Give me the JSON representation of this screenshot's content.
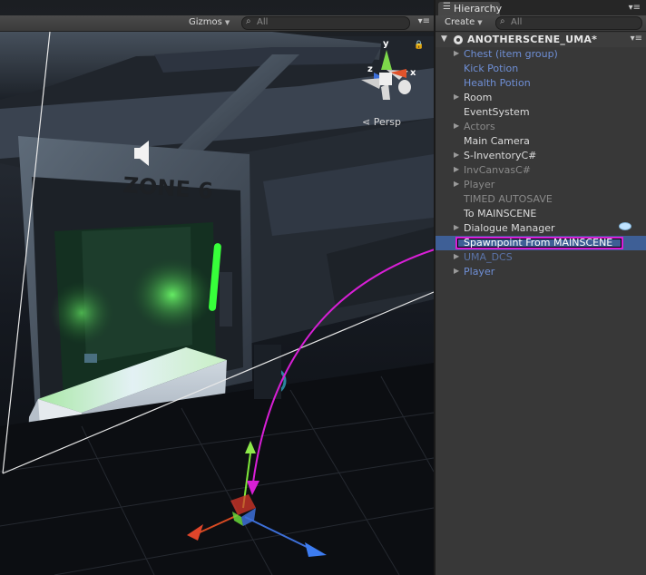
{
  "scene_view": {
    "gizmos_label": "Gizmos",
    "search_placeholder": "All",
    "persp_label": "Persp",
    "scene_text": "ZONE 6",
    "axis_labels": {
      "y": "y",
      "x": "x",
      "z": "z"
    },
    "icons": [
      "speaker-icon",
      "lock-icon",
      "orientation-gizmo",
      "move-tool-gizmo",
      "panel-menu-icon",
      "search-icon"
    ]
  },
  "hierarchy": {
    "tab_label": "Hierarchy",
    "create_label": "Create",
    "search_placeholder": "All",
    "scene_name": "ANOTHERSCENE_UMA*",
    "items": [
      {
        "label": "Chest (item group)",
        "style": "prefab",
        "expandable": true
      },
      {
        "label": "Kick Potion",
        "style": "prefab",
        "expandable": false
      },
      {
        "label": "Health Potion",
        "style": "prefab",
        "expandable": false
      },
      {
        "label": "Room",
        "style": "normal",
        "expandable": true
      },
      {
        "label": "EventSystem",
        "style": "normal",
        "expandable": false
      },
      {
        "label": "Actors",
        "style": "inactive",
        "expandable": true
      },
      {
        "label": "Main Camera",
        "style": "normal",
        "expandable": false
      },
      {
        "label": "S-InventoryC#",
        "style": "normal",
        "expandable": true
      },
      {
        "label": "InvCanvasC#",
        "style": "inactive",
        "expandable": true
      },
      {
        "label": "Player",
        "style": "inactive",
        "expandable": true
      },
      {
        "label": "TIMED AUTOSAVE",
        "style": "inactive",
        "expandable": false
      },
      {
        "label": "To MAINSCENE",
        "style": "normal",
        "expandable": false
      },
      {
        "label": "Dialogue Manager",
        "style": "normal",
        "expandable": true
      },
      {
        "label": "Spawnpoint From MAINSCENE",
        "style": "selected",
        "expandable": false
      },
      {
        "label": "UMA_DCS",
        "style": "prefab-inactive",
        "expandable": true
      },
      {
        "label": "Player",
        "style": "prefab",
        "expandable": true
      }
    ]
  },
  "colors": {
    "selection_bg": "#3e5f96",
    "annotation_magenta": "#d81fd6",
    "prefab_blue": "#6f8fd6",
    "neon_green": "#37ff3a"
  }
}
